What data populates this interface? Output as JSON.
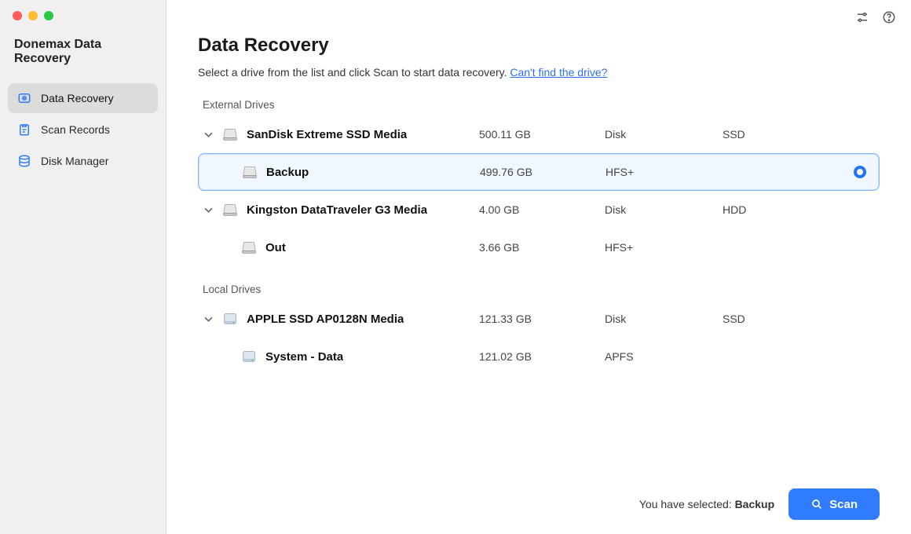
{
  "app": {
    "title": "Donemax Data Recovery"
  },
  "sidebar": {
    "items": [
      {
        "label": "Data Recovery",
        "icon": "hard-drive"
      },
      {
        "label": "Scan Records",
        "icon": "clipboard"
      },
      {
        "label": "Disk Manager",
        "icon": "disks"
      }
    ],
    "active_index": 0
  },
  "header": {
    "title": "Data Recovery",
    "subtitle_prefix": "Select a drive from the list and click Scan to start data recovery. ",
    "subtitle_link": "Can't find the drive?"
  },
  "sections": {
    "external_label": "External Drives",
    "local_label": "Local Drives"
  },
  "drives": {
    "external": [
      {
        "name": "SanDisk Extreme SSD Media",
        "size": "500.11 GB",
        "kind": "Disk",
        "media": "SSD",
        "expanded": true,
        "volumes": [
          {
            "name": "Backup",
            "size": "499.76 GB",
            "fs": "HFS+",
            "selected": true
          }
        ]
      },
      {
        "name": "Kingston DataTraveler G3 Media",
        "size": "4.00 GB",
        "kind": "Disk",
        "media": "HDD",
        "expanded": true,
        "volumes": [
          {
            "name": "Out",
            "size": "3.66 GB",
            "fs": "HFS+",
            "selected": false
          }
        ]
      }
    ],
    "local": [
      {
        "name": "APPLE SSD AP0128N Media",
        "size": "121.33 GB",
        "kind": "Disk",
        "media": "SSD",
        "expanded": true,
        "volumes": [
          {
            "name": "System - Data",
            "size": "121.02 GB",
            "fs": "APFS",
            "selected": false
          }
        ]
      }
    ]
  },
  "footer": {
    "selected_prefix": "You have selected: ",
    "selected_name": "Backup",
    "scan_label": "Scan"
  }
}
